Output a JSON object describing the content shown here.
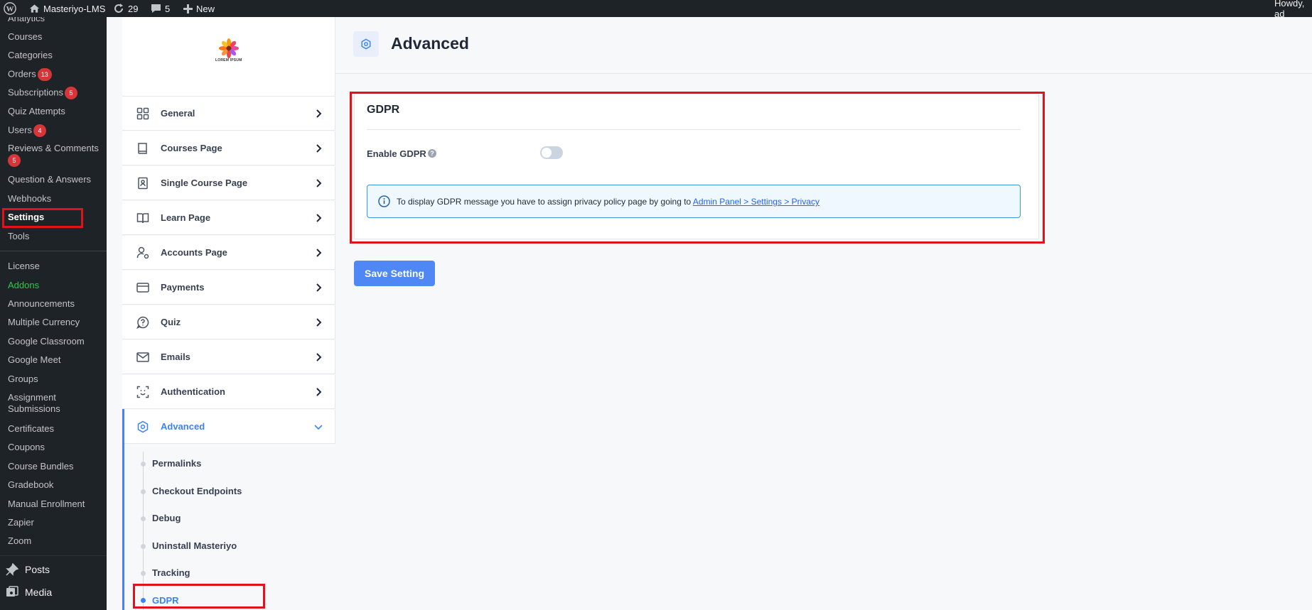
{
  "adminbar": {
    "site_name": "Masteriyo-LMS",
    "updates_count": "29",
    "comments_count": "5",
    "new_label": "New",
    "greeting": "Howdy, ad"
  },
  "wp_menu": {
    "items": [
      {
        "label": "Analytics"
      },
      {
        "label": "Courses"
      },
      {
        "label": "Categories"
      },
      {
        "label": "Orders",
        "badge": "13"
      },
      {
        "label": "Subscriptions",
        "badge": "5"
      },
      {
        "label": "Quiz Attempts"
      },
      {
        "label": "Users",
        "badge": "4"
      },
      {
        "label": "Reviews & Comments",
        "badge": "5"
      },
      {
        "label": "Question & Answers"
      },
      {
        "label": "Webhooks"
      },
      {
        "label": "Settings"
      },
      {
        "label": "Tools"
      },
      {
        "label": "License"
      },
      {
        "label": "Addons"
      },
      {
        "label": "Announcements"
      },
      {
        "label": "Multiple Currency"
      },
      {
        "label": "Google Classroom"
      },
      {
        "label": "Google Meet"
      },
      {
        "label": "Groups"
      },
      {
        "label": "Assignment Submissions"
      },
      {
        "label": "Certificates"
      },
      {
        "label": "Coupons"
      },
      {
        "label": "Course Bundles"
      },
      {
        "label": "Gradebook"
      },
      {
        "label": "Manual Enrollment"
      },
      {
        "label": "Zapier"
      },
      {
        "label": "Zoom"
      }
    ],
    "posts_label": "Posts",
    "media_label": "Media"
  },
  "settings_nav": {
    "logo_text": "LOREM IPSUM",
    "items": [
      {
        "label": "General",
        "icon": "grid-icon"
      },
      {
        "label": "Courses Page",
        "icon": "book-icon"
      },
      {
        "label": "Single Course Page",
        "icon": "id-card-icon"
      },
      {
        "label": "Learn Page",
        "icon": "open-book-icon"
      },
      {
        "label": "Accounts Page",
        "icon": "user-gear-icon"
      },
      {
        "label": "Payments",
        "icon": "credit-card-icon"
      },
      {
        "label": "Quiz",
        "icon": "question-bubble-icon"
      },
      {
        "label": "Emails",
        "icon": "envelope-icon"
      },
      {
        "label": "Authentication",
        "icon": "face-scan-icon"
      },
      {
        "label": "Advanced",
        "icon": "gear-icon"
      }
    ],
    "advanced_subitems": [
      {
        "label": "Permalinks"
      },
      {
        "label": "Checkout Endpoints"
      },
      {
        "label": "Debug"
      },
      {
        "label": "Uninstall Masteriyo"
      },
      {
        "label": "Tracking"
      },
      {
        "label": "GDPR"
      }
    ]
  },
  "main": {
    "page_title": "Advanced",
    "card_title": "GDPR",
    "enable_label": "Enable GDPR",
    "help_glyph": "?",
    "enable_state": false,
    "info_text": "To display GDPR message you have to assign privacy policy page by going to ",
    "info_link": "Admin Panel > Settings > Privacy",
    "save_label": "Save Setting"
  },
  "colors": {
    "accent": "#3b82f6",
    "save_button": "#4f87f5",
    "wp_dark": "#1d2327",
    "highlight_red": "#e0121c",
    "addons_green": "#1ed14b"
  }
}
